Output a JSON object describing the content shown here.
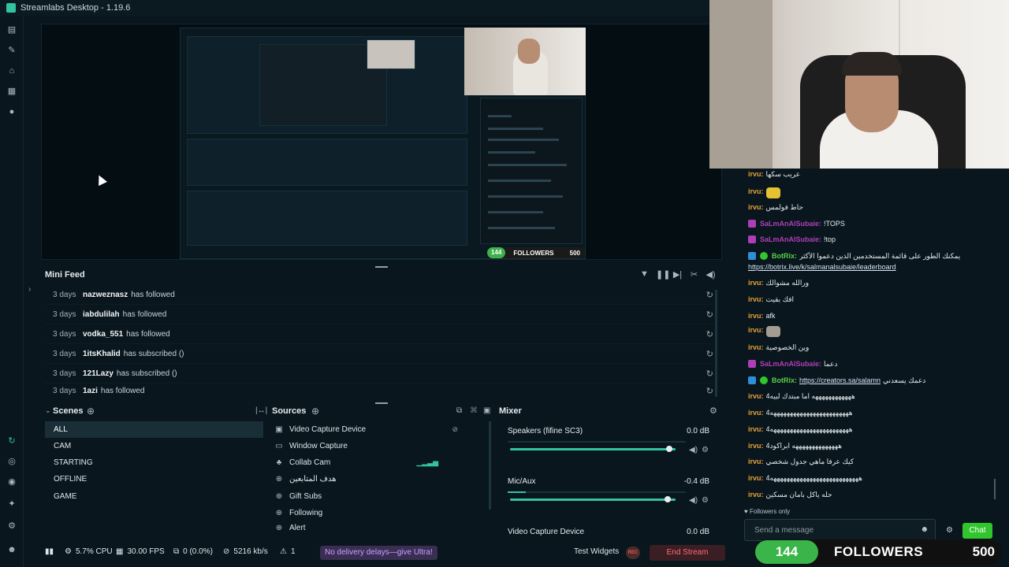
{
  "window": {
    "title": "Streamlabs Desktop - 1.19.6"
  },
  "minifeed": {
    "title": "Mini Feed",
    "rows": [
      {
        "age": "3 days",
        "user": "nazweznasz",
        "action": "has followed"
      },
      {
        "age": "3 days",
        "user": "iabdulilah",
        "action": "has followed"
      },
      {
        "age": "3 days",
        "user": "vodka_551",
        "action": "has followed"
      },
      {
        "age": "3 days",
        "user": "1itsKhalid",
        "action": "has subscribed ()"
      },
      {
        "age": "3 days",
        "user": "121Lazy",
        "action": "has subscribed ()"
      },
      {
        "age": "3 days",
        "user": "1azi",
        "action": "has followed"
      }
    ]
  },
  "scenes": {
    "title": "Scenes",
    "items": [
      "ALL",
      "CAM",
      "STARTING",
      "OFFLINE",
      "GAME"
    ],
    "active": "ALL"
  },
  "sources": {
    "title": "Sources",
    "items": [
      {
        "label": "Video Capture Device",
        "icon": "camera-icon"
      },
      {
        "label": "Window Capture",
        "icon": "window-icon"
      },
      {
        "label": "Collab Cam",
        "icon": "collab-icon"
      },
      {
        "label": "هدف المتابعين",
        "icon": "globe-icon"
      },
      {
        "label": "Gift Subs",
        "icon": "globe-icon"
      },
      {
        "label": "Following",
        "icon": "globe-icon"
      },
      {
        "label": "Alert",
        "icon": "globe-icon"
      }
    ]
  },
  "mixer": {
    "title": "Mixer",
    "items": [
      {
        "name": "Speakers (fifine SC3)",
        "db": "0.0 dB",
        "level": 0.0,
        "volume": 0.96
      },
      {
        "name": "Mic/Aux",
        "db": "-0.4 dB",
        "level": 0.1,
        "volume": 0.95
      },
      {
        "name": "Video Capture Device",
        "db": "0.0 dB",
        "level": 0.0,
        "volume": 0.96
      }
    ]
  },
  "status": {
    "cpu": "5.7% CPU",
    "fps": "30.00 FPS",
    "dropped": "0 (0.0%)",
    "bitrate": "5216 kb/s",
    "alert_count": "1",
    "ultra": "No delivery delays—give Ultra!",
    "test_widgets": "Test Widgets",
    "rec": "REC",
    "end_stream": "End Stream"
  },
  "chat": {
    "messages": [
      {
        "user": "irvu:",
        "color": "#e8a03a",
        "text": "عريب سكها"
      },
      {
        "user": "irvu:",
        "color": "#e8a03a",
        "text": "",
        "emote": "#e6c233"
      },
      {
        "user": "irvu:",
        "color": "#e8a03a",
        "text": "حاط فولمس"
      },
      {
        "user": "SaLmAnAlSubaie:",
        "color": "#b03db8",
        "text": "!TOPS",
        "badge": "#b03db8"
      },
      {
        "user": "SaLmAnAlSubaie:",
        "color": "#b03db8",
        "text": "!top",
        "badge": "#b03db8"
      },
      {
        "user": "BotRix:",
        "color": "#58d04a",
        "text": "يمكنك الطور على قائمة المستخدمين الذين دعموا الأكثر",
        "badge": "#2d8fd6"
      },
      {
        "user": "",
        "color": "#e5ebee",
        "text": "https://botrix.live/k/salmanalsubaie/leaderboard",
        "link": true
      },
      {
        "user": "irvu:",
        "color": "#e8a03a",
        "text": "ورالله مشوالك"
      },
      {
        "user": "irvu:",
        "color": "#e8a03a",
        "text": "افك بقيت"
      },
      {
        "user": "irvu:",
        "color": "#e8a03a",
        "text": "afk"
      },
      {
        "user": "irvu:",
        "color": "#e8a03a",
        "text": "",
        "emote": "#a49b92"
      },
      {
        "user": "irvu:",
        "color": "#e8a03a",
        "text": "وين الخصوصية"
      },
      {
        "user": "SaLmAnAlSubaie:",
        "color": "#b03db8",
        "text": "دعما",
        "badge": "#b03db8"
      },
      {
        "user": "BotRix:",
        "color": "#58d04a",
        "text": "https://creators.sa/salamn",
        "suffix": "دعمك يسعدني",
        "badge": "#2d8fd6",
        "link": true
      },
      {
        "user": "irvu:",
        "color": "#e8a03a",
        "text": "4ههههههههههههه اما مبتدك لبيه"
      },
      {
        "user": "irvu:",
        "color": "#e8a03a",
        "text": "4ههههههههههههههههههههههههه"
      },
      {
        "user": "irvu:",
        "color": "#e8a03a",
        "text": "4ههههههههههههههههههههههههه"
      },
      {
        "user": "irvu:",
        "color": "#e8a03a",
        "text": "4ههههههههههههههه ابراكود"
      },
      {
        "user": "irvu:",
        "color": "#e8a03a",
        "text": "كيك عرفا ماهي جدول شخصي"
      },
      {
        "user": "irvu:",
        "color": "#e8a03a",
        "text": "4هههههههههههههههههههههههههههه"
      },
      {
        "user": "irvu:",
        "color": "#e8a03a",
        "text": "حله ياكل بامان مسكين"
      }
    ],
    "followers_only": "Followers only",
    "input_placeholder": "Send a message",
    "send_label": "Chat"
  },
  "followers_widget": {
    "count": "144",
    "label": "FOLLOWERS",
    "goal": "500"
  },
  "preview_widget": {
    "count": "144",
    "label": "FOLLOWERS",
    "goal": "500"
  },
  "colors": {
    "accent": "#31c3a2",
    "chat_send": "#31c62d",
    "end_stream": "#ff6b74",
    "ultra": "#c9a2ff"
  }
}
